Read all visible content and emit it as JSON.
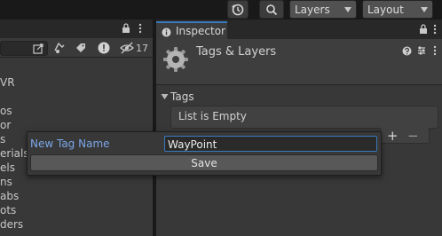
{
  "toolbar": {
    "history_icon": "history-icon",
    "search_icon": "search-icon",
    "layers_dropdown": "Layers",
    "layout_dropdown": "Layout"
  },
  "left_panel": {
    "toolbar_icons": [
      "scene-view-icon",
      "filter-icon",
      "tag-icon",
      "warning-icon",
      "visibility-icon"
    ],
    "hidden_count": "17",
    "items": [
      "VR",
      "os",
      "or",
      "s",
      "erials",
      "els",
      "ns",
      "abs",
      "ots",
      "ders"
    ]
  },
  "inspector": {
    "tab_label": "Inspector",
    "title": "Tags & Layers",
    "tags_section": "Tags",
    "tags_empty": "List is Empty",
    "add_label": "+",
    "remove_label": "−"
  },
  "popup": {
    "label": "New Tag Name",
    "value": "WayPoint",
    "save_label": "Save"
  },
  "colors": {
    "accent": "#3a79bb",
    "label_blue": "#7ba6e8"
  }
}
